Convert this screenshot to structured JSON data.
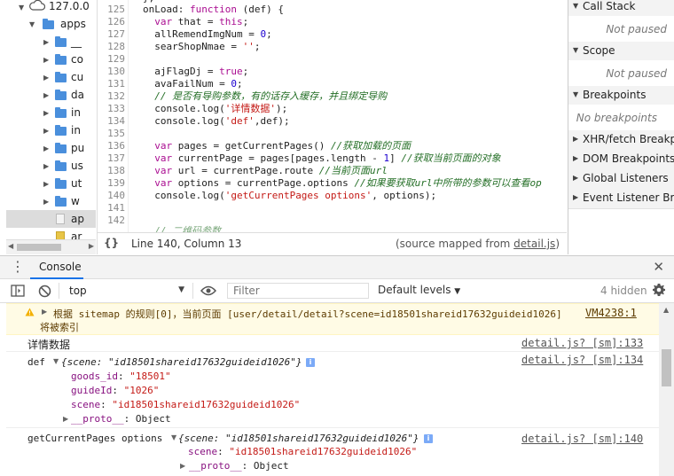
{
  "tree": {
    "root_label": "127.0.0",
    "items": [
      {
        "label": "apps",
        "kind": "folder",
        "expanded": true
      },
      {
        "label": "__",
        "kind": "folder"
      },
      {
        "label": "co",
        "kind": "folder"
      },
      {
        "label": "cu",
        "kind": "folder"
      },
      {
        "label": "da",
        "kind": "folder"
      },
      {
        "label": "in",
        "kind": "folder"
      },
      {
        "label": "in",
        "kind": "folder"
      },
      {
        "label": "pu",
        "kind": "folder"
      },
      {
        "label": "us",
        "kind": "folder"
      },
      {
        "label": "ut",
        "kind": "folder"
      },
      {
        "label": "w",
        "kind": "folder"
      },
      {
        "label": "ap",
        "kind": "file",
        "selected": true
      },
      {
        "label": "ar",
        "kind": "file"
      }
    ]
  },
  "editor": {
    "lines": [
      {
        "n": "125",
        "html": "onLoad: <span class='kw'>function</span> (def) {"
      },
      {
        "n": "126",
        "html": "  <span class='kw'>var</span> that = <span class='kw'>this</span>;"
      },
      {
        "n": "127",
        "html": "  allRemendImgNum = <span class='num'>0</span>;"
      },
      {
        "n": "128",
        "html": "  searShopNmae = <span class='str'>''</span>;"
      },
      {
        "n": "129",
        "html": ""
      },
      {
        "n": "130",
        "html": "  ajFlagDj = <span class='kw'>true</span>;"
      },
      {
        "n": "131",
        "html": "  avaFailNum = <span class='num'>0</span>;"
      },
      {
        "n": "132",
        "html": "  <span class='cmt'>// 是否有导购参数，有的话存入缓存，并且绑定导购</span>"
      },
      {
        "n": "133",
        "html": "  console.log(<span class='str'>'详情数据'</span>);"
      },
      {
        "n": "134",
        "html": "  console.log(<span class='str'>'def'</span>,def);"
      },
      {
        "n": "135",
        "html": ""
      },
      {
        "n": "136",
        "html": "  <span class='kw'>var</span> pages = getCurrentPages() <span class='cmt'>//获取加载的页面</span>"
      },
      {
        "n": "137",
        "html": "  <span class='kw'>var</span> currentPage = pages[pages.length - <span class='num'>1</span>] <span class='cmt'>//获取当前页面的对象</span>"
      },
      {
        "n": "138",
        "html": "  <span class='kw'>var</span> url = currentPage.route <span class='cmt'>//当前页面url</span>"
      },
      {
        "n": "139",
        "html": "  <span class='kw'>var</span> options = currentPage.options <span class='cmt'>//如果要获取url中所带的参数可以查看op</span>"
      },
      {
        "n": "140",
        "html": "  console.log(<span class='str'>'getCurrentPages options'</span>, options);"
      },
      {
        "n": "141",
        "html": ""
      },
      {
        "n": "142",
        "html": ""
      }
    ]
  },
  "status": {
    "braces": "{}",
    "position": "Line 140, Column 13",
    "source_prefix": "(source mapped from ",
    "source_file": "detail.js",
    "source_suffix": ")"
  },
  "sidebar": {
    "sections": [
      {
        "label": "Call Stack",
        "body": "Not paused"
      },
      {
        "label": "Scope",
        "body": "Not paused"
      },
      {
        "label": "Breakpoints",
        "body": "No breakpoints"
      },
      {
        "label": "XHR/fetch Breakpoints",
        "body": null
      },
      {
        "label": "DOM Breakpoints",
        "body": null
      },
      {
        "label": "Global Listeners",
        "body": null
      },
      {
        "label": "Event Listener Breakpoints",
        "body": null
      }
    ]
  },
  "console": {
    "tab_label": "Console",
    "context": "top",
    "filter_placeholder": "Filter",
    "levels_label": "Default levels",
    "hidden_count": "4 hidden",
    "warning": {
      "text_line1": "根据 sitemap 的规则[0]，当前页面 [user/detail/detail?scene=id18501shareid17632guideid1026]",
      "text_line2": "将被索引",
      "source": "VM4238:1"
    },
    "log1": {
      "text": "详情数据",
      "source": "detail.js? [sm]:133"
    },
    "log2": {
      "prefix": "def",
      "summary": "{scene: \"id18501shareid17632guideid1026\"}",
      "props": [
        {
          "key": "goods_id",
          "value": "\"18501\""
        },
        {
          "key": "guideId",
          "value": "\"1026\""
        },
        {
          "key": "scene",
          "value": "\"id18501shareid17632guideid1026\""
        }
      ],
      "proto": "__proto__",
      "proto_value": "Object",
      "source": "detail.js? [sm]:134"
    },
    "log3": {
      "prefix": "getCurrentPages options",
      "summary": "{scene: \"id18501shareid17632guideid1026\"}",
      "props": [
        {
          "key": "scene",
          "value": "\"id18501shareid17632guideid1026\""
        }
      ],
      "proto": "__proto__",
      "proto_value": "Object",
      "source": "detail.js? [sm]:140"
    }
  },
  "colors": {
    "accent": "#1a73e8",
    "folder": "#4a8fdc",
    "warning_bg": "#fffbe5"
  }
}
